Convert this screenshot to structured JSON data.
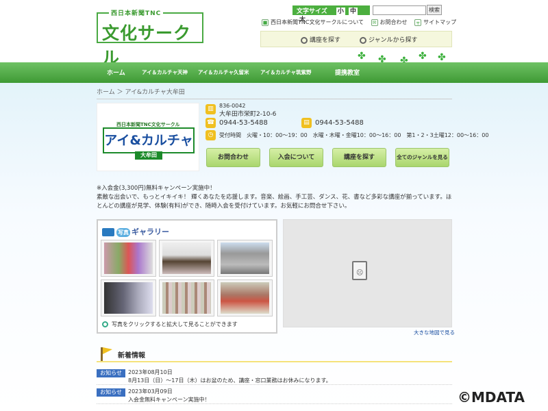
{
  "header": {
    "logo_top": "西日本新聞TNC",
    "logo_main": "文化サークル",
    "fontsize_label": "文字サイズ",
    "fontsize_small": "小",
    "fontsize_medium": "中",
    "fontsize_large": "大",
    "search_placeholder": "",
    "search_button": "検索",
    "util_links": [
      "西日本新聞TNC文化サークルについて",
      "お問合わせ",
      "サイトマップ"
    ],
    "search_tabs": [
      "講座を探す",
      "ジャンルから探す"
    ]
  },
  "nav": {
    "items": [
      "ホーム",
      "アイ＆カルチャ天神",
      "アイ＆カルチャ久留米",
      "アイ＆カルチャ筑紫野",
      "提携教室"
    ]
  },
  "breadcrumb": "ホーム ＞ アイ&カルチャ大牟田",
  "shop": {
    "logo_small": "西日本新聞TNC文化サークル",
    "logo_main": "アイ&カルチャ",
    "logo_sub": "大牟田",
    "postal": "836-0042",
    "address": "大牟田市栄町2-10-6",
    "tel": "0944-53-5488",
    "fax": "0944-53-5488",
    "hours": "受付時間　火曜・10：00～19：00　水曜・木曜・金曜10：00～16：00　第1・2・3土曜12：00～16：00"
  },
  "actions": [
    "お問合わせ",
    "入会について",
    "講座を探す",
    "全てのジャンルを見る"
  ],
  "notice": {
    "line1": "※入会金(3,300円)無料キャンペーン実施中！",
    "line2": "素敵な出会いで、もっとイキイキ！ 輝くあなたを応援します。音楽、絵画、手工芸、ダンス、花、書など多彩な講座が揃っています。ほとんどの講座が見学、体験(有料)ができ、随時入会を受付けています。お気軽にお問合せ下さい。"
  },
  "gallery": {
    "tag": "写真",
    "title": "ギャラリー",
    "hint": "写真をクリックすると拡大して見ることができます"
  },
  "map_link": "大きな地図で見る",
  "news": {
    "title": "新着情報",
    "items": [
      {
        "badge": "お知らせ",
        "date": "2023年08月10日",
        "text": "8月13日（日）～17日（木）はお盆のため、講座・窓口業務はお休みになります。"
      },
      {
        "badge": "お知らせ",
        "date": "2023年03月09日",
        "text": "入会金無料キャンペーン実施中！"
      }
    ]
  },
  "watermark": "©MDATA",
  "colors": {
    "nav_green": "#4caf3f",
    "logo_green": "#3a9a2f",
    "badge_blue": "#3a6fc0",
    "button_green": "#a9d66d"
  }
}
